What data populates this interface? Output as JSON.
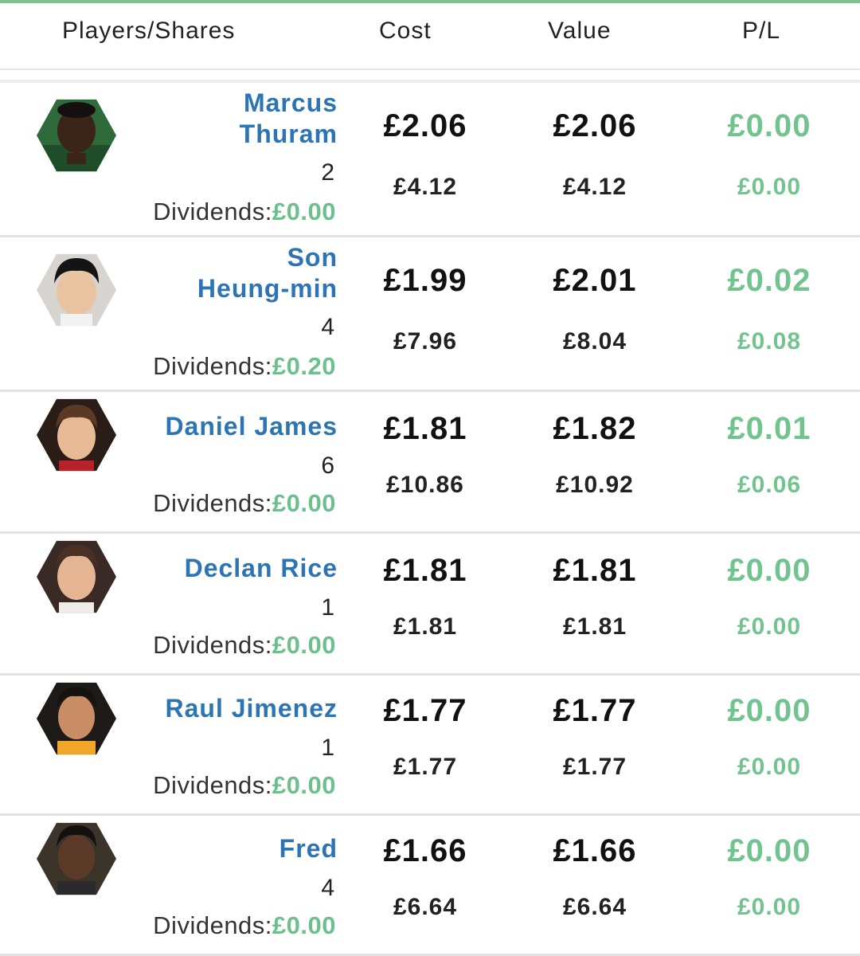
{
  "header": {
    "players_label": "Players/Shares",
    "cost_label": "Cost",
    "value_label": "Value",
    "pl_label": "P/L"
  },
  "dividends_label": "Dividends:",
  "colors": {
    "accent": "#7dc48e",
    "name": "#2c74b3",
    "profit": "#72c48f"
  },
  "players": [
    {
      "name_line1": "Marcus",
      "name_line2": "Thuram",
      "shares": "2",
      "dividends": "£0.00",
      "cost": "£2.06",
      "cost_total": "£4.12",
      "value": "£2.06",
      "value_total": "£4.12",
      "pl": "£0.00",
      "pl_total": "£0.00",
      "avatar_icon": "player-photo"
    },
    {
      "name_line1": "Son",
      "name_line2": "Heung-min",
      "shares": "4",
      "dividends": "£0.20",
      "cost": "£1.99",
      "cost_total": "£7.96",
      "value": "£2.01",
      "value_total": "£8.04",
      "pl": "£0.02",
      "pl_total": "£0.08",
      "avatar_icon": "player-photo"
    },
    {
      "name_line1": "Daniel James",
      "name_line2": "",
      "shares": "6",
      "dividends": "£0.00",
      "cost": "£1.81",
      "cost_total": "£10.86",
      "value": "£1.82",
      "value_total": "£10.92",
      "pl": "£0.01",
      "pl_total": "£0.06",
      "avatar_icon": "player-photo"
    },
    {
      "name_line1": "Declan Rice",
      "name_line2": "",
      "shares": "1",
      "dividends": "£0.00",
      "cost": "£1.81",
      "cost_total": "£1.81",
      "value": "£1.81",
      "value_total": "£1.81",
      "pl": "£0.00",
      "pl_total": "£0.00",
      "avatar_icon": "player-photo"
    },
    {
      "name_line1": "Raul Jimenez",
      "name_line2": "",
      "shares": "1",
      "dividends": "£0.00",
      "cost": "£1.77",
      "cost_total": "£1.77",
      "value": "£1.77",
      "value_total": "£1.77",
      "pl": "£0.00",
      "pl_total": "£0.00",
      "avatar_icon": "player-photo"
    },
    {
      "name_line1": "Fred",
      "name_line2": "",
      "shares": "4",
      "dividends": "£0.00",
      "cost": "£1.66",
      "cost_total": "£6.64",
      "value": "£1.66",
      "value_total": "£6.64",
      "pl": "£0.00",
      "pl_total": "£0.00",
      "avatar_icon": "player-photo"
    }
  ]
}
